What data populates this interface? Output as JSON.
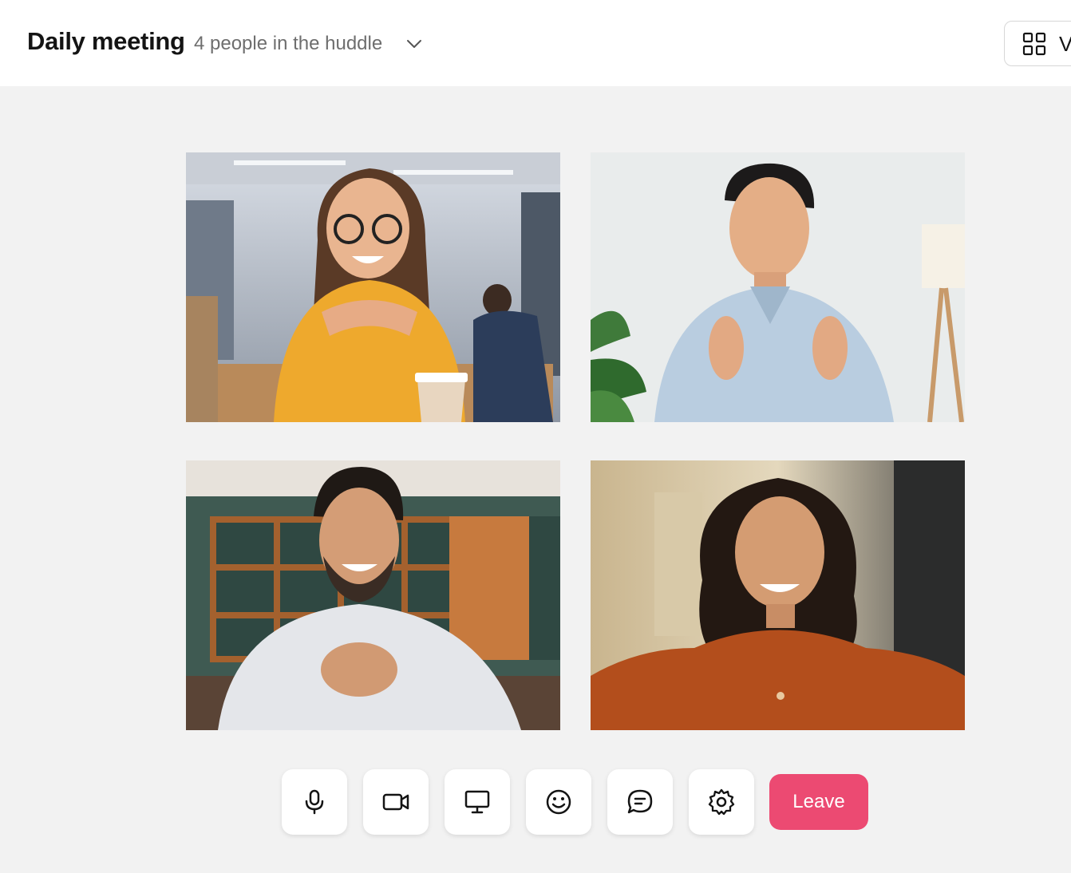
{
  "header": {
    "title": "Daily meeting",
    "subtitle": "4 people in the huddle",
    "view_button_label": "V",
    "dropdown_icon": "chevron-down-icon",
    "view_icon": "grid-icon"
  },
  "participants": [
    {
      "name": "participant-woman-glasses-yellow-shirt"
    },
    {
      "name": "participant-man-blue-shirt"
    },
    {
      "name": "participant-man-striped-shirt"
    },
    {
      "name": "participant-woman-orange-shirt"
    }
  ],
  "controls": {
    "mic_icon": "microphone-icon",
    "camera_icon": "video-camera-icon",
    "share_icon": "screen-share-icon",
    "reaction_icon": "smiley-icon",
    "chat_icon": "chat-icon",
    "settings_icon": "gear-icon",
    "leave_label": "Leave"
  },
  "colors": {
    "background": "#f2f2f2",
    "header": "#ffffff",
    "leave_button": "#ec4a72"
  }
}
